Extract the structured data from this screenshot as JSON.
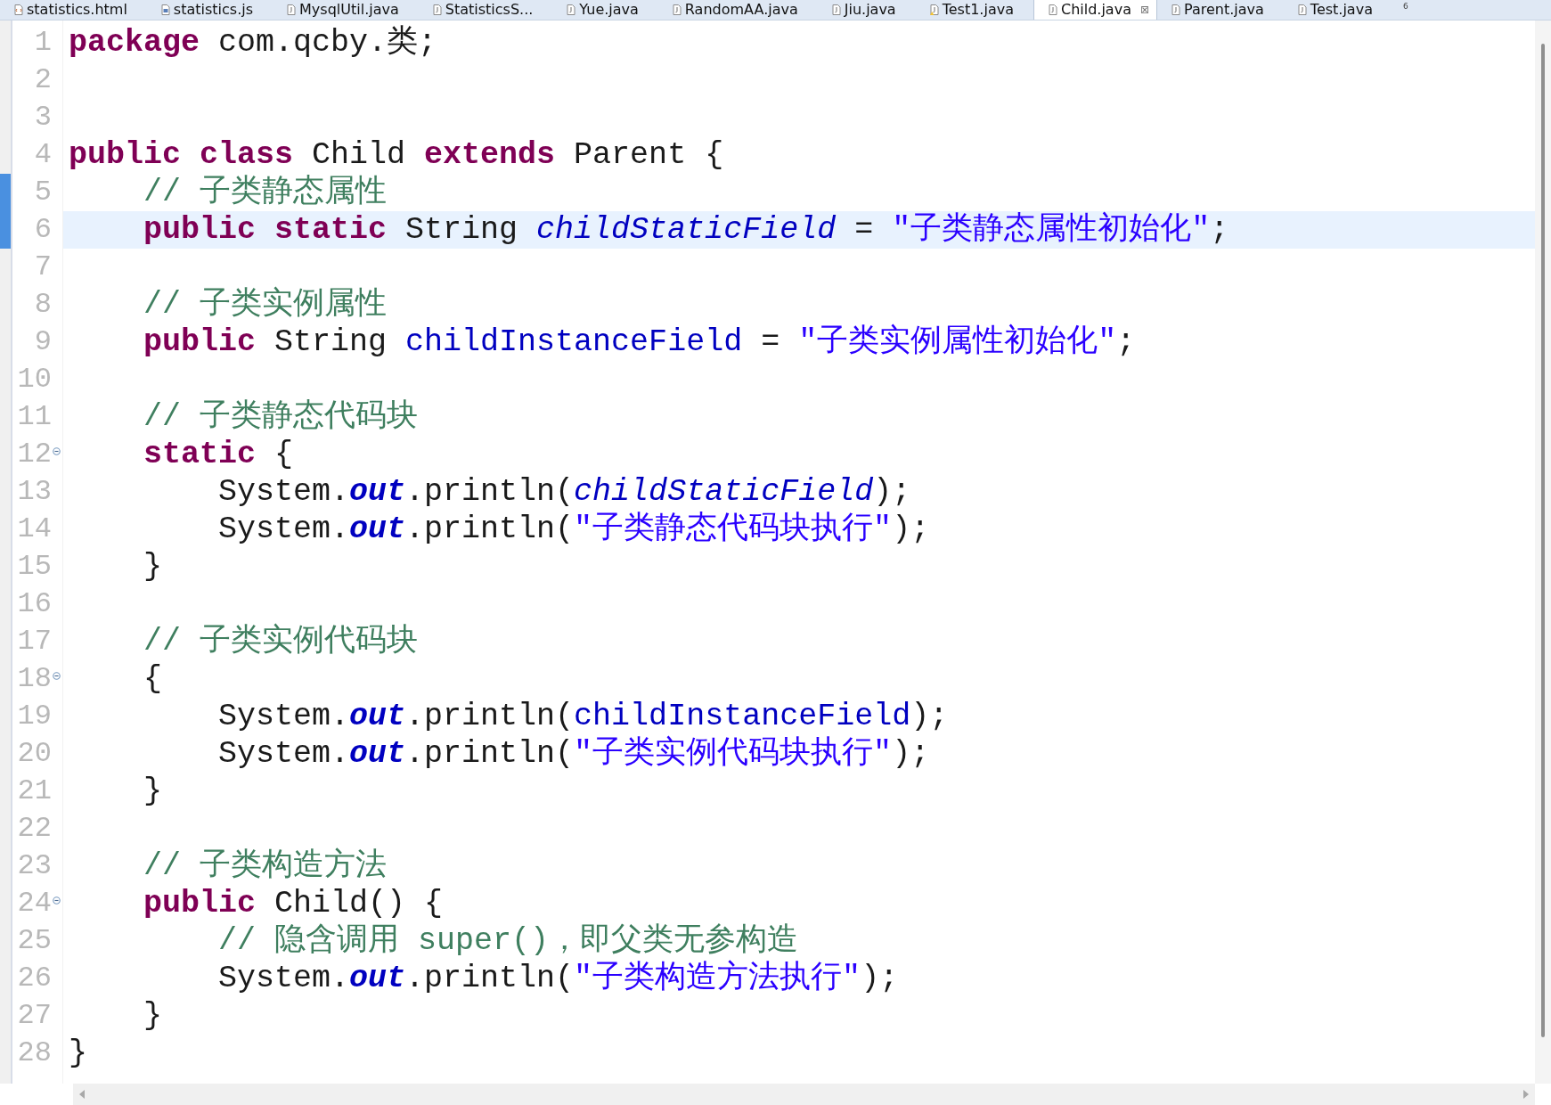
{
  "tabs": [
    {
      "label": "statistics.html",
      "kind": "html",
      "selected": false
    },
    {
      "label": "statistics.js",
      "kind": "js",
      "selected": false
    },
    {
      "label": "MysqlUtil.java",
      "kind": "java",
      "selected": false
    },
    {
      "label": "StatisticsS...",
      "kind": "java",
      "selected": false
    },
    {
      "label": "Yue.java",
      "kind": "java",
      "selected": false
    },
    {
      "label": "RandomAA.java",
      "kind": "java",
      "selected": false
    },
    {
      "label": "Jiu.java",
      "kind": "java",
      "selected": false
    },
    {
      "label": "Test1.java",
      "kind": "warning",
      "selected": false
    },
    {
      "label": "Child.java",
      "kind": "java",
      "selected": true,
      "close": "⊠"
    },
    {
      "label": "Parent.java",
      "kind": "java",
      "selected": false
    },
    {
      "label": "Test.java",
      "kind": "java",
      "selected": false
    }
  ],
  "overflow_count": "6",
  "editor": {
    "lines": [
      {
        "number": "1",
        "tokens": [
          {
            "kind": "keyword",
            "text": "package "
          },
          {
            "kind": "plain",
            "text": "com.qcby.类;"
          }
        ]
      },
      {
        "number": "2"
      },
      {
        "number": "3"
      },
      {
        "number": "4",
        "tokens": [
          {
            "kind": "keyword",
            "text": "public class "
          },
          {
            "kind": "plain",
            "text": "Child "
          },
          {
            "kind": "keyword",
            "text": "extends "
          },
          {
            "kind": "plain",
            "text": "Parent {"
          }
        ]
      },
      {
        "number": "5",
        "changed": true,
        "tokens": [
          {
            "kind": "comment",
            "text": "    // 子类静态属性"
          }
        ]
      },
      {
        "number": "6",
        "changed": true,
        "current": true,
        "tokens": [
          {
            "kind": "keyword",
            "text": "    public static "
          },
          {
            "kind": "plain",
            "text": "String "
          },
          {
            "kind": "static-field",
            "text": "childStaticField"
          },
          {
            "kind": "plain",
            "text": " = "
          },
          {
            "kind": "string",
            "text": "\"子类静态属性初始化\""
          },
          {
            "kind": "plain",
            "text": ";"
          }
        ]
      },
      {
        "number": "7"
      },
      {
        "number": "8",
        "tokens": [
          {
            "kind": "comment",
            "text": "    // 子类实例属性"
          }
        ]
      },
      {
        "number": "9",
        "tokens": [
          {
            "kind": "keyword",
            "text": "    public "
          },
          {
            "kind": "plain",
            "text": "String "
          },
          {
            "kind": "field",
            "text": "childInstanceField"
          },
          {
            "kind": "plain",
            "text": " = "
          },
          {
            "kind": "string",
            "text": "\"子类实例属性初始化\""
          },
          {
            "kind": "plain",
            "text": ";"
          }
        ]
      },
      {
        "number": "10"
      },
      {
        "number": "11",
        "tokens": [
          {
            "kind": "comment",
            "text": "    // 子类静态代码块"
          }
        ]
      },
      {
        "number": "12",
        "fold": true,
        "tokens": [
          {
            "kind": "keyword",
            "text": "    static "
          },
          {
            "kind": "plain",
            "text": "{"
          }
        ]
      },
      {
        "number": "13",
        "tokens": [
          {
            "kind": "plain",
            "text": "        System."
          },
          {
            "kind": "static-ref",
            "text": "out"
          },
          {
            "kind": "plain",
            "text": ".println("
          },
          {
            "kind": "static-field",
            "text": "childStaticField"
          },
          {
            "kind": "plain",
            "text": ");"
          }
        ]
      },
      {
        "number": "14",
        "tokens": [
          {
            "kind": "plain",
            "text": "        System."
          },
          {
            "kind": "static-ref",
            "text": "out"
          },
          {
            "kind": "plain",
            "text": ".println("
          },
          {
            "kind": "string",
            "text": "\"子类静态代码块执行\""
          },
          {
            "kind": "plain",
            "text": ");"
          }
        ]
      },
      {
        "number": "15",
        "tokens": [
          {
            "kind": "plain",
            "text": "    }"
          }
        ]
      },
      {
        "number": "16"
      },
      {
        "number": "17",
        "tokens": [
          {
            "kind": "comment",
            "text": "    // 子类实例代码块"
          }
        ]
      },
      {
        "number": "18",
        "fold": true,
        "tokens": [
          {
            "kind": "plain",
            "text": "    {"
          }
        ]
      },
      {
        "number": "19",
        "tokens": [
          {
            "kind": "plain",
            "text": "        System."
          },
          {
            "kind": "static-ref",
            "text": "out"
          },
          {
            "kind": "plain",
            "text": ".println("
          },
          {
            "kind": "field",
            "text": "childInstanceField"
          },
          {
            "kind": "plain",
            "text": ");"
          }
        ]
      },
      {
        "number": "20",
        "tokens": [
          {
            "kind": "plain",
            "text": "        System."
          },
          {
            "kind": "static-ref",
            "text": "out"
          },
          {
            "kind": "plain",
            "text": ".println("
          },
          {
            "kind": "string",
            "text": "\"子类实例代码块执行\""
          },
          {
            "kind": "plain",
            "text": ");"
          }
        ]
      },
      {
        "number": "21",
        "tokens": [
          {
            "kind": "plain",
            "text": "    }"
          }
        ]
      },
      {
        "number": "22"
      },
      {
        "number": "23",
        "tokens": [
          {
            "kind": "comment",
            "text": "    // 子类构造方法"
          }
        ]
      },
      {
        "number": "24",
        "fold": true,
        "tokens": [
          {
            "kind": "keyword",
            "text": "    public "
          },
          {
            "kind": "plain",
            "text": "Child() {"
          }
        ]
      },
      {
        "number": "25",
        "tokens": [
          {
            "kind": "comment",
            "text": "        // 隐含调用 super()，即父类无参构造"
          }
        ]
      },
      {
        "number": "26",
        "tokens": [
          {
            "kind": "plain",
            "text": "        System."
          },
          {
            "kind": "static-ref",
            "text": "out"
          },
          {
            "kind": "plain",
            "text": ".println("
          },
          {
            "kind": "string",
            "text": "\"子类构造方法执行\""
          },
          {
            "kind": "plain",
            "text": ");"
          }
        ]
      },
      {
        "number": "27",
        "tokens": [
          {
            "kind": "plain",
            "text": "    }"
          }
        ]
      },
      {
        "number": "28",
        "tokens": [
          {
            "kind": "plain",
            "text": "}"
          }
        ]
      }
    ]
  }
}
